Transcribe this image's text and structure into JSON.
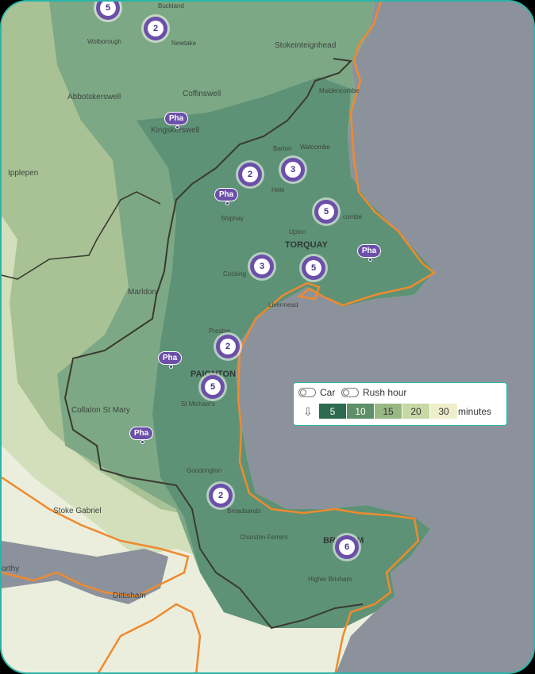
{
  "map": {
    "places": [
      {
        "id": "wolborough",
        "name": "Wolborough"
      },
      {
        "id": "buckland",
        "name": "Buckland"
      },
      {
        "id": "newtake",
        "name": "Newtake"
      },
      {
        "id": "stokeinteignhead",
        "name": "Stokeinteignhead"
      },
      {
        "id": "maidencombe",
        "name": "Maidencombe"
      },
      {
        "id": "abbotskerswell",
        "name": "Abbotskerswell"
      },
      {
        "id": "coffinswell",
        "name": "Coffinswell"
      },
      {
        "id": "kingskerswell",
        "name": "Kingskerswell"
      },
      {
        "id": "barton",
        "name": "Barton"
      },
      {
        "id": "watcombe",
        "name": "Watcombe"
      },
      {
        "id": "ipplepen",
        "name": "Ipplepen"
      },
      {
        "id": "hele",
        "name": "Hele"
      },
      {
        "id": "shiphay",
        "name": "Shiphay"
      },
      {
        "id": "upton",
        "name": "Upton"
      },
      {
        "id": "torquay",
        "name": "TORQUAY"
      },
      {
        "id": "combe",
        "name": "combe"
      },
      {
        "id": "cockington",
        "name": "Cocking"
      },
      {
        "id": "livermead",
        "name": "Livermead"
      },
      {
        "id": "marldon",
        "name": "Marldon"
      },
      {
        "id": "preston",
        "name": "Preston"
      },
      {
        "id": "paignton",
        "name": "PAIGNTON"
      },
      {
        "id": "st-michaels",
        "name": "St Michael's"
      },
      {
        "id": "collaton",
        "name": "Collaton St Mary"
      },
      {
        "id": "goodrington",
        "name": "Goodrington"
      },
      {
        "id": "broadsands",
        "name": "Broadsands"
      },
      {
        "id": "stoke-gabriel",
        "name": "Stoke Gabriel"
      },
      {
        "id": "churston",
        "name": "Churston Ferrers"
      },
      {
        "id": "brixham",
        "name": "BRIXHAM"
      },
      {
        "id": "higher-brixham",
        "name": "Higher Brixham"
      },
      {
        "id": "dittisham",
        "name": "Dittisham"
      },
      {
        "id": "worthy",
        "name": "orthy"
      }
    ],
    "clusters": [
      {
        "id": "c1",
        "count": "5"
      },
      {
        "id": "c2",
        "count": "2"
      },
      {
        "id": "c3",
        "count": "2"
      },
      {
        "id": "c4",
        "count": "3"
      },
      {
        "id": "c5",
        "count": "5"
      },
      {
        "id": "c6",
        "count": "3"
      },
      {
        "id": "c7",
        "count": "5"
      },
      {
        "id": "c8",
        "count": "2"
      },
      {
        "id": "c9",
        "count": "5"
      },
      {
        "id": "c10",
        "count": "2"
      },
      {
        "id": "c11",
        "count": "6"
      }
    ],
    "pharmacy_label": "Pha"
  },
  "legend": {
    "car_label": "Car",
    "rush_hour_label": "Rush hour",
    "bins": [
      {
        "label": "5",
        "color": "#2d6a4f",
        "text": "#ffffff"
      },
      {
        "label": "10",
        "color": "#5d9068",
        "text": "#ffffff"
      },
      {
        "label": "15",
        "color": "#97b783",
        "text": "#333333"
      },
      {
        "label": "20",
        "color": "#c7d8a4",
        "text": "#333333"
      },
      {
        "label": "30",
        "color": "#eeeecc",
        "text": "#333333"
      }
    ],
    "units": "minutes"
  },
  "colors": {
    "sea": "#8c929c",
    "frame_border": "#2ab6a8",
    "pharmacy": "#6b4fa8",
    "coast_boundary": "#ef8a2e",
    "admin_boundary": "#3a3a30"
  }
}
